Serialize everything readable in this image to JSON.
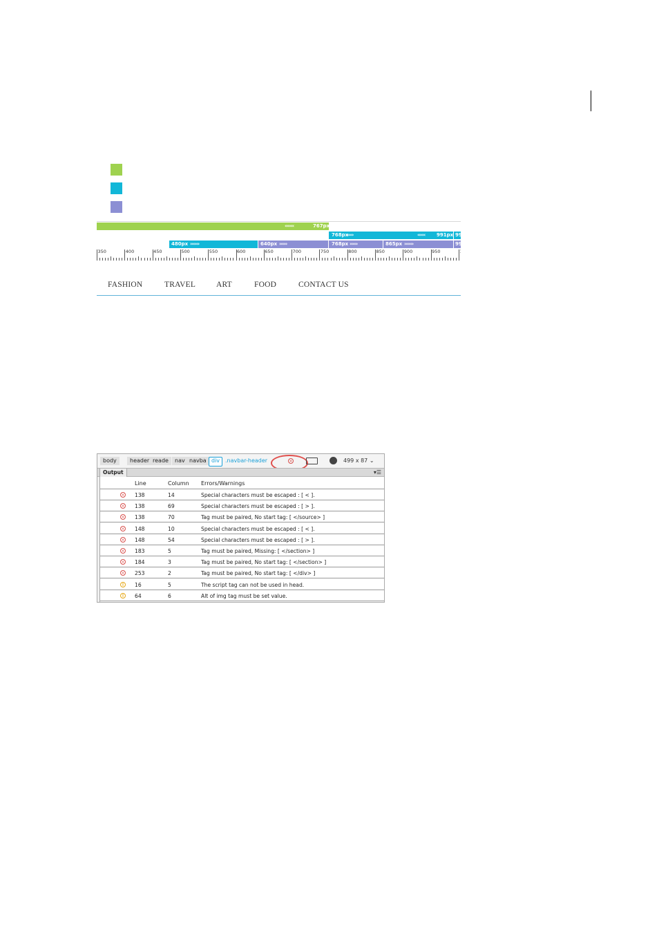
{
  "legend": {
    "colors": [
      "#9fd24f",
      "#12b7d8",
      "#8c8fd4"
    ]
  },
  "media_queries": {
    "rows": [
      [
        {
          "label": "767px",
          "color": "#9fd24f",
          "chevrons": "left"
        }
      ],
      [
        {
          "label": "768px",
          "color": "#12b7d8",
          "chevrons": "right"
        },
        {
          "label": "991px",
          "color": "#12b7d8",
          "chevrons": "left"
        },
        {
          "label": "99",
          "color": "#12b7d8",
          "chevrons": "none"
        }
      ],
      [
        {
          "label": "480px",
          "color": "#8c8fd4",
          "chevrons": "right"
        },
        {
          "label": "640px",
          "color": "#8c8fd4",
          "chevrons": "right"
        },
        {
          "label": "768px",
          "color": "#8c8fd4",
          "chevrons": "right"
        },
        {
          "label": "865px",
          "color": "#8c8fd4",
          "chevrons": "right"
        },
        {
          "label": "99",
          "color": "#8c8fd4",
          "chevrons": "none"
        }
      ]
    ],
    "ruler_labels": [
      "350",
      "400",
      "450",
      "500",
      "550",
      "600",
      "650",
      "700",
      "750",
      "800",
      "850",
      "900",
      "950",
      "1"
    ]
  },
  "nav": {
    "items": [
      "FASHION",
      "TRAVEL",
      "ART",
      "FOOD",
      "CONTACT US"
    ]
  },
  "panel": {
    "breadcrumbs": [
      "body",
      "header",
      "reade",
      "nav",
      "navba"
    ],
    "selected_tag": "div",
    "selected_class": ".navbar-header",
    "error_icon": "error-circle-icon",
    "device_icon": "device-preview-icon",
    "dimensions": "499 x 87 ⌄",
    "output_tab": "Output",
    "menu_icon": "▾☰",
    "headers": {
      "line": "Line",
      "column": "Column",
      "message": "Errors/Warnings"
    },
    "rows": [
      {
        "type": "error",
        "line": "138",
        "column": "14",
        "message": "Special characters must be escaped : [ < ]."
      },
      {
        "type": "error",
        "line": "138",
        "column": "69",
        "message": "Special characters must be escaped : [ > ]."
      },
      {
        "type": "error",
        "line": "138",
        "column": "70",
        "message": "Tag must be paired, No start tag: [ </source> ]"
      },
      {
        "type": "error",
        "line": "148",
        "column": "10",
        "message": "Special characters must be escaped : [ < ]."
      },
      {
        "type": "error",
        "line": "148",
        "column": "54",
        "message": "Special characters must be escaped : [ > ]."
      },
      {
        "type": "error",
        "line": "183",
        "column": "5",
        "message": "Tag must be paired, Missing: [ </section> ]"
      },
      {
        "type": "error",
        "line": "184",
        "column": "3",
        "message": "Tag must be paired, No start tag: [ </section> ]"
      },
      {
        "type": "error",
        "line": "253",
        "column": "2",
        "message": "Tag must be paired, No start tag: [ </div> ]"
      },
      {
        "type": "warning",
        "line": "16",
        "column": "5",
        "message": "The script tag can not be used in head."
      },
      {
        "type": "warning",
        "line": "64",
        "column": "6",
        "message": "Alt of img tag must be set value."
      }
    ]
  }
}
